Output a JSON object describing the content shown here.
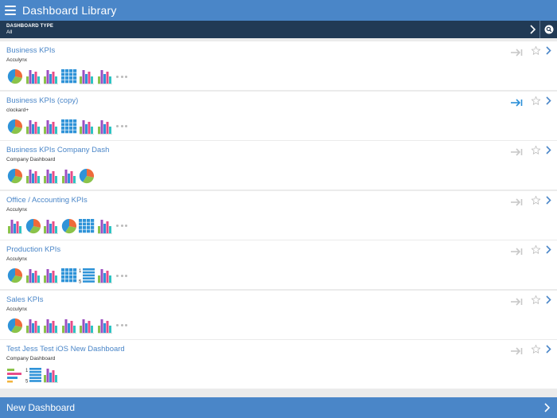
{
  "header": {
    "title": "Dashboard Library",
    "menu_icon": "hamburger-icon"
  },
  "filter": {
    "label": "DASHBOARD TYPE",
    "value": "All",
    "search_icon": "search-icon"
  },
  "colors": {
    "accent": "#4a86c8",
    "filter_bar": "#213a55",
    "pin_active": "#2a8fd8",
    "pin_inactive": "#c8c8c8"
  },
  "dashboards": [
    {
      "title": "Business KPIs",
      "subtitle": "Acculynx",
      "pinned": false,
      "widgets": [
        "pie",
        "bar",
        "bar",
        "table",
        "bar",
        "bar"
      ],
      "more": true
    },
    {
      "title": "Business KPIs (copy)",
      "subtitle": "clockard+",
      "pinned": true,
      "widgets": [
        "pie",
        "bar",
        "bar",
        "table",
        "bar",
        "bar"
      ],
      "more": true
    },
    {
      "title": "Business KPIs Company Dash",
      "subtitle": "Company Dashboard",
      "pinned": false,
      "widgets": [
        "pie",
        "bar",
        "bar",
        "bar",
        "pie"
      ],
      "more": false
    },
    {
      "title": "Office / Accounting KPIs",
      "subtitle": "Acculynx",
      "pinned": false,
      "widgets": [
        "bar",
        "pie",
        "bar",
        "pie",
        "table",
        "bar"
      ],
      "more": true
    },
    {
      "title": "Production KPIs",
      "subtitle": "Acculynx",
      "pinned": false,
      "widgets": [
        "pie",
        "bar",
        "bar",
        "table",
        "list",
        "bar"
      ],
      "more": true
    },
    {
      "title": "Sales KPIs",
      "subtitle": "Acculynx",
      "pinned": false,
      "widgets": [
        "pie",
        "bar",
        "bar",
        "bar",
        "bar",
        "bar"
      ],
      "more": true
    },
    {
      "title": "Test Jess Test iOS New Dashboard",
      "subtitle": "Company Dashboard",
      "pinned": false,
      "widgets": [
        "hbar",
        "list",
        "bar"
      ],
      "more": false
    }
  ],
  "footer": {
    "new_label": "New Dashboard"
  }
}
